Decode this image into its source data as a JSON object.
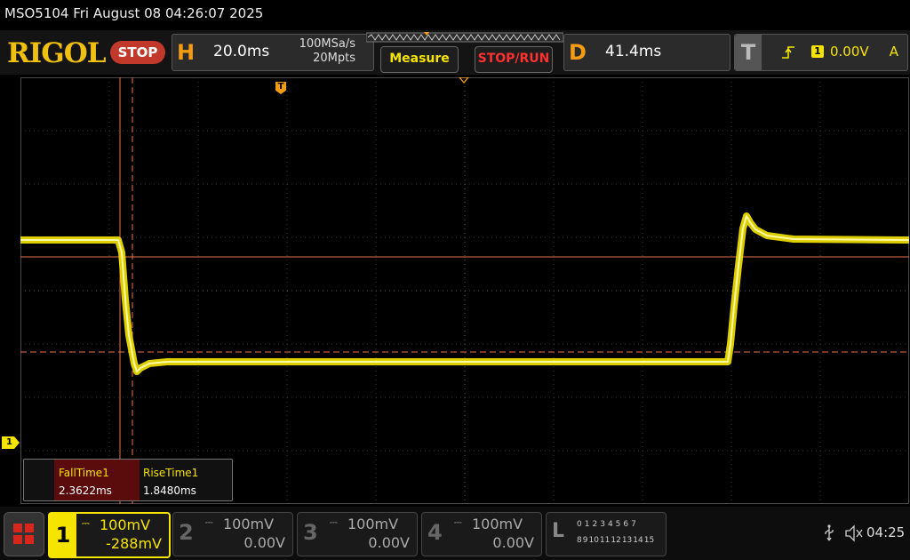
{
  "titlebar": {
    "text": "MSO5104  Fri August 08 04:26:07 2025"
  },
  "toolbar": {
    "logo": "RIGOL",
    "run_state": "STOP",
    "horizontal": {
      "letter": "H",
      "timebase": "20.0ms",
      "sample_rate": "100MSa/s",
      "memory_depth": "20Mpts"
    },
    "measure_label": "Measure",
    "stop_run_label": "STOP/RUN",
    "delay": {
      "letter": "D",
      "value": "41.4ms"
    },
    "trigger": {
      "letter": "T",
      "source_icon": "1",
      "level": "0.00V",
      "mode": "A"
    }
  },
  "markers": {
    "ch1_ground": "1",
    "trigger_pos": "T"
  },
  "measurements": {
    "headers": [
      "FallTime1",
      "RiseTime1"
    ],
    "values": [
      "2.3622ms",
      "1.8480ms"
    ]
  },
  "channels": [
    {
      "num": "1",
      "scale": "100mV",
      "offset": "-288mV",
      "color": "#f5e400",
      "active": true
    },
    {
      "num": "2",
      "scale": "100mV",
      "offset": "0.00V",
      "color": "#555555",
      "active": false
    },
    {
      "num": "3",
      "scale": "100mV",
      "offset": "0.00V",
      "color": "#555555",
      "active": false
    },
    {
      "num": "4",
      "scale": "100mV",
      "offset": "0.00V",
      "color": "#555555",
      "active": false
    }
  ],
  "logic": {
    "letter": "L",
    "row1": [
      "0",
      "1",
      "2",
      "3",
      "4",
      "5",
      "6",
      "7"
    ],
    "row2": [
      "8",
      "9",
      "10",
      "11",
      "12",
      "13",
      "14",
      "15"
    ]
  },
  "status": {
    "time": "04:25"
  },
  "colors": {
    "trace": "#f5e400",
    "cursor": "#e8734a",
    "accent": "#f39c12"
  }
}
